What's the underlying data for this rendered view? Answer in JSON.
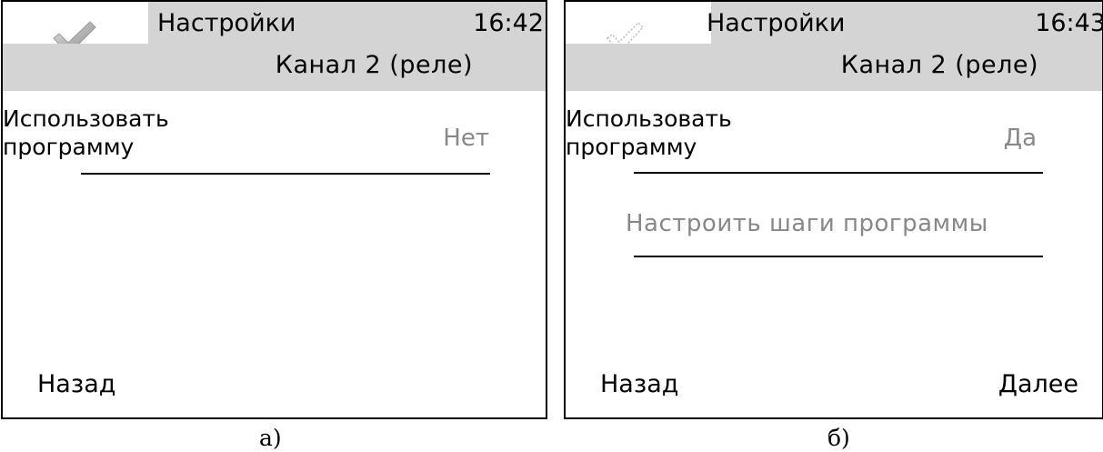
{
  "screen_a": {
    "title": "Настройки",
    "clock": "16:42",
    "subtitle": "Канал 2 (реле)",
    "field_label": "Использовать программу",
    "field_label_line1": "Использовать",
    "field_label_line2": "программу",
    "field_value": "Нет",
    "back_label": "Назад",
    "check_icon": "checkmark-icon",
    "caption": "а)"
  },
  "screen_b": {
    "title": "Настройки",
    "clock": "16:43",
    "subtitle": "Канал 2 (реле)",
    "field_label_line1": "Использовать",
    "field_label_line2": "программу",
    "field_value": "Да",
    "menu_link": "Настроить шаги программы",
    "back_label": "Назад",
    "next_label": "Далее",
    "check_icon": "checkmark-dotted-icon",
    "caption": "б)"
  },
  "colors": {
    "header_bg": "#d4d4d4",
    "inactive_text": "#888888",
    "text": "#000000"
  }
}
